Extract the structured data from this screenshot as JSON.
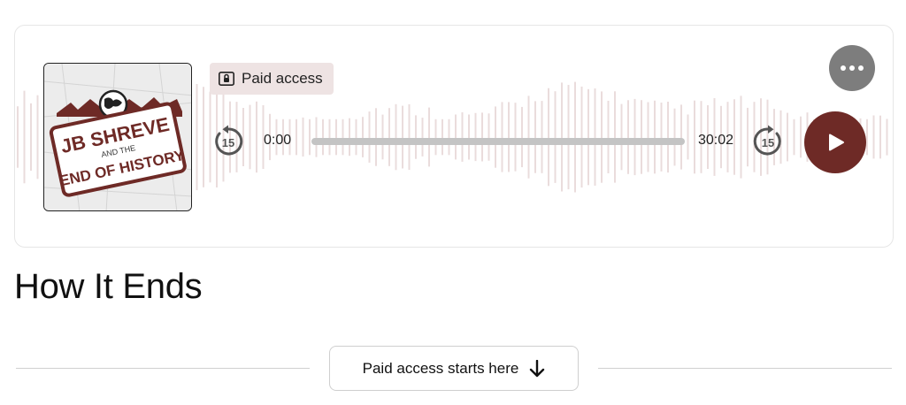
{
  "player": {
    "badge_label": "Paid access",
    "current_time": "0:00",
    "total_time": "30:02",
    "progress": 0,
    "skip_back_seconds": "15",
    "skip_forward_seconds": "15",
    "cover_art": {
      "line1": "JB SHREVE",
      "line2": "AND THE",
      "line3": "END OF HISTORY"
    },
    "colors": {
      "accent": "#6e2a26",
      "waveform": "#eadcdc",
      "badge_bg": "#eee3e3",
      "more_button": "#7d7d7d"
    }
  },
  "episode": {
    "title": "How It Ends"
  },
  "paywall": {
    "button_label": "Paid access starts here"
  }
}
